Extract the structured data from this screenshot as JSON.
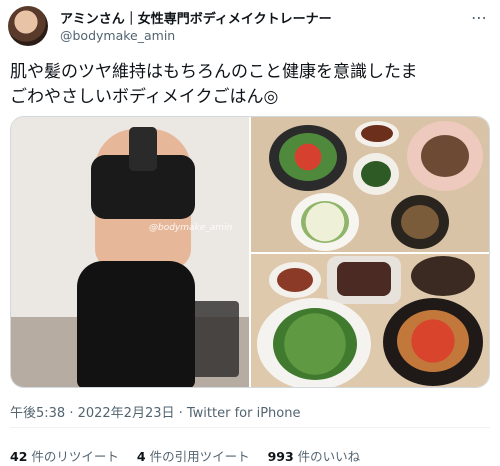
{
  "author": {
    "display_name": "アミンさん｜女性専門ボディメイクトレーナー",
    "handle": "@bodymake_amin"
  },
  "tweet": {
    "text_line1": "肌や髪のツヤ維持はもちろんのこと健康を意識したま",
    "text_line2": "ごわやさしいボディメイクごはん◎"
  },
  "media": {
    "watermark": "@bodymake_amin"
  },
  "meta": {
    "time": "午後5:38 · 2022年2月23日 · Twitter for iPhone"
  },
  "stats": {
    "retweets_count": "42",
    "retweets_label": "件のリツイート",
    "quotes_count": "4",
    "quotes_label": "件の引用ツイート",
    "likes_count": "993",
    "likes_label": "件のいいね"
  },
  "colors": {
    "secondary_text": "#536471",
    "divider": "#eff3f4"
  },
  "icons": {
    "more": "more-horizontal-icon"
  }
}
